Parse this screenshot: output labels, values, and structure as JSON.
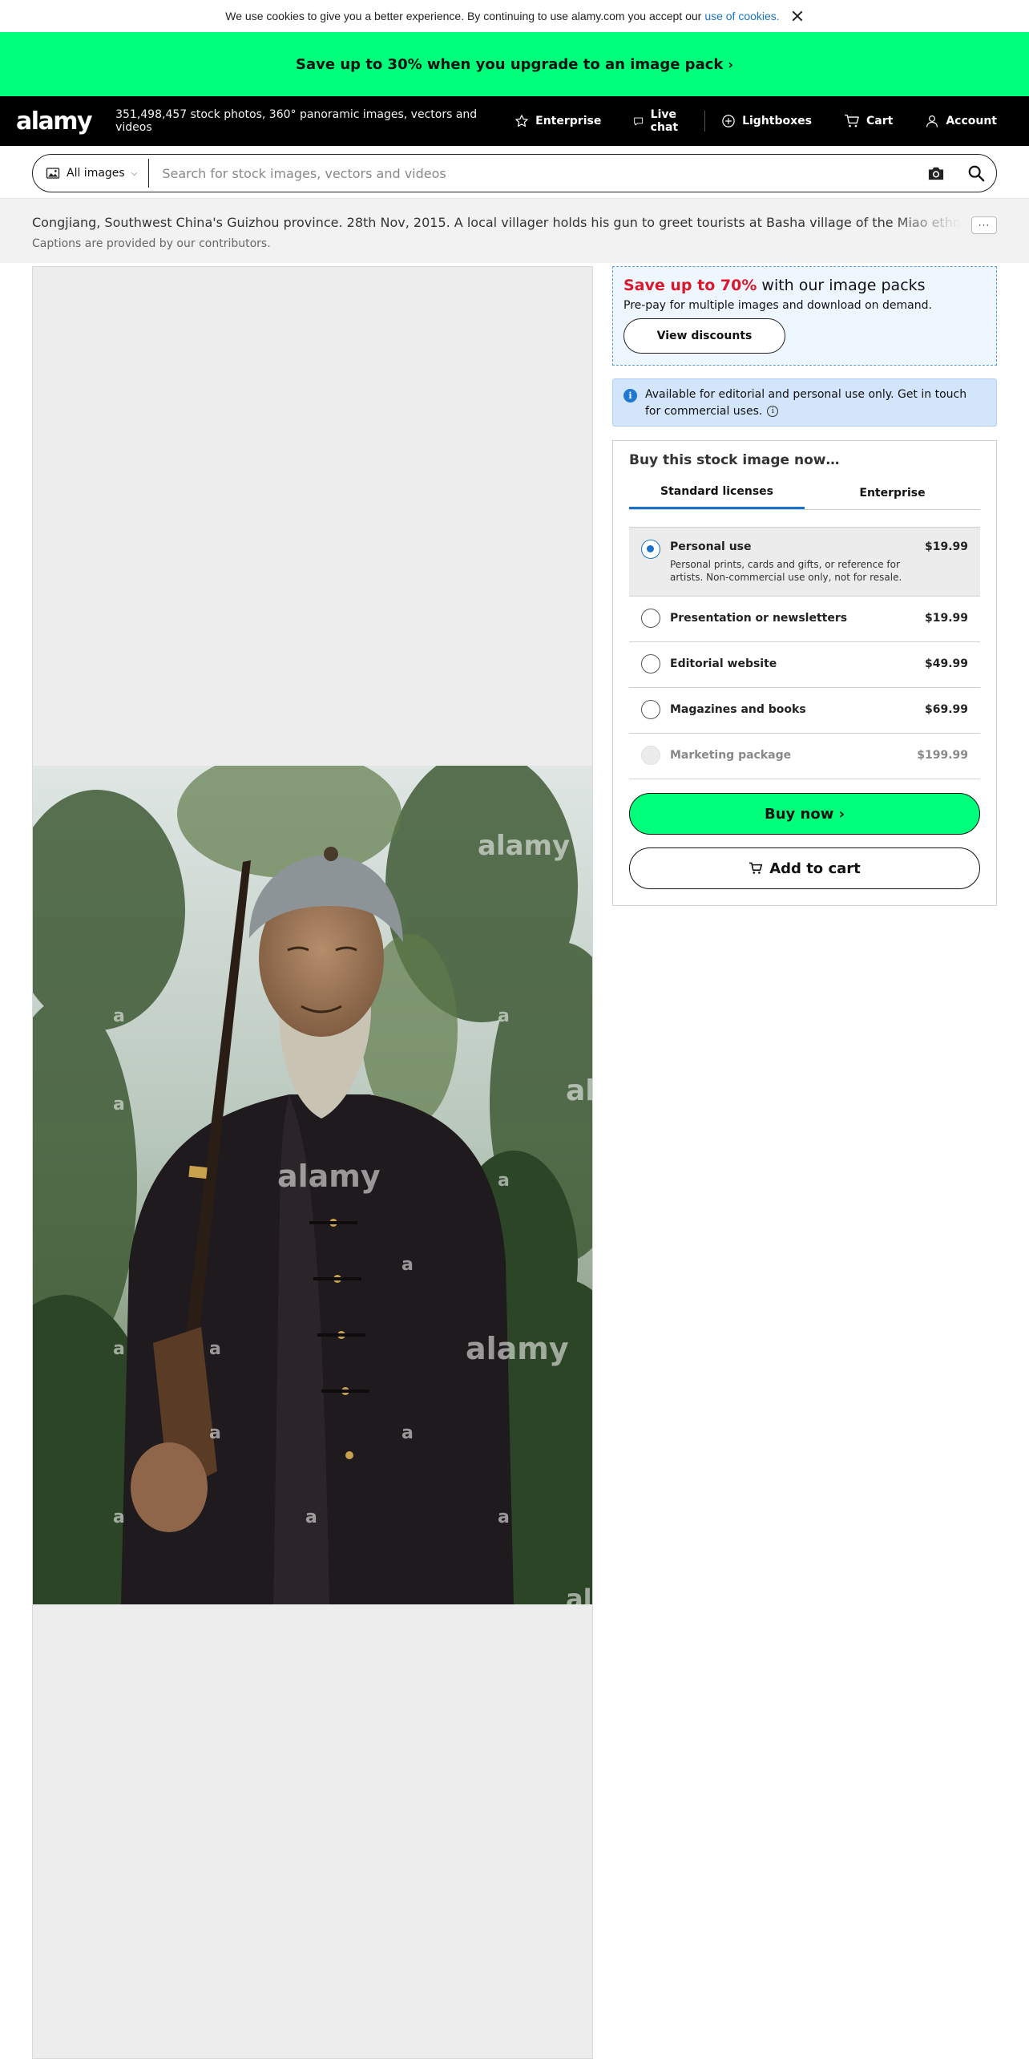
{
  "cookie": {
    "text": "We use cookies to give you a better experience. By continuing to use alamy.com you accept our",
    "link": "use of cookies."
  },
  "promo": {
    "text": "Save up to 30% when you upgrade to an image pack",
    "chevron": "›"
  },
  "header": {
    "logo": "alamy",
    "tagline": "351,498,457 stock photos, 360° panoramic images, vectors and videos",
    "nav": {
      "enterprise": "Enterprise",
      "live_chat": "Live chat",
      "lightboxes": "Lightboxes",
      "cart": "Cart",
      "account": "Account"
    }
  },
  "search": {
    "category": "All images",
    "placeholder": "Search for stock images, vectors and videos"
  },
  "caption": {
    "text": "Congjiang, Southwest China's Guizhou province. 28th Nov, 2015. A local villager holds his gun to greet tourists at Basha village of the Miao ethnic group in",
    "more": "···",
    "note": "Captions are provided by our contributors."
  },
  "watermarks": [
    "alamy",
    "a"
  ],
  "discount": {
    "highlight": "Save up to 70%",
    "title_rest": " with our image packs",
    "subtitle": "Pre-pay for multiple images and download on demand.",
    "button": "View discounts"
  },
  "info": {
    "text": "Available for editorial and personal use only. Get in touch for commercial uses."
  },
  "buy": {
    "title": "Buy this stock image now…",
    "tabs": [
      "Standard licenses",
      "Enterprise"
    ],
    "licenses": [
      {
        "name": "Personal use",
        "price": "$19.99",
        "desc": "Personal prints, cards and gifts, or reference for artists. Non-commercial use only, not for resale.",
        "selected": true
      },
      {
        "name": "Presentation or newsletters",
        "price": "$19.99"
      },
      {
        "name": "Editorial website",
        "price": "$49.99"
      },
      {
        "name": "Magazines and books",
        "price": "$69.99"
      },
      {
        "name": "Marketing package",
        "price": "$199.99",
        "disabled": true
      }
    ],
    "buy_now": "Buy now ›",
    "add_to_cart": "Add to cart"
  },
  "colors": {
    "promo_green": "#00ff7b",
    "accent_blue": "#1a73c8",
    "discount_red": "#d9182b"
  }
}
